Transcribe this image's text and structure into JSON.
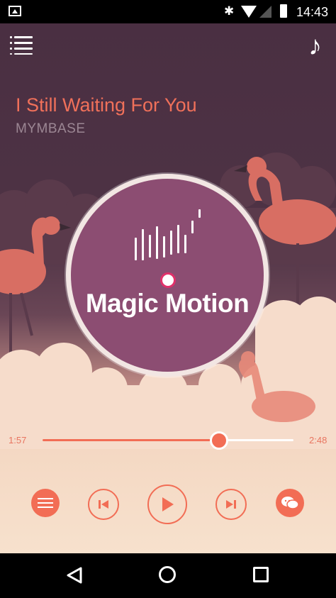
{
  "status": {
    "time": "14:43",
    "icons": [
      "image-icon",
      "bluetooth-icon",
      "wifi-icon",
      "signal-icon",
      "battery-icon"
    ]
  },
  "header": {
    "menu_icon": "list-icon",
    "music_icon": "music-note-icon"
  },
  "track": {
    "title": "I Still Waiting For You",
    "artist": "MYMBASE"
  },
  "logo": {
    "text": "Magic Motion"
  },
  "player": {
    "elapsed": "1:57",
    "total": "2:48",
    "progress_fraction": 0.7
  },
  "controls": [
    "playlist-icon",
    "previous-icon",
    "play-icon",
    "next-icon",
    "wechat-icon"
  ],
  "colors": {
    "accent": "#f26d55",
    "title": "#f0705a",
    "artist": "#9c8794",
    "disc": "#8c4d72",
    "bg_top": "#4a2f42"
  }
}
